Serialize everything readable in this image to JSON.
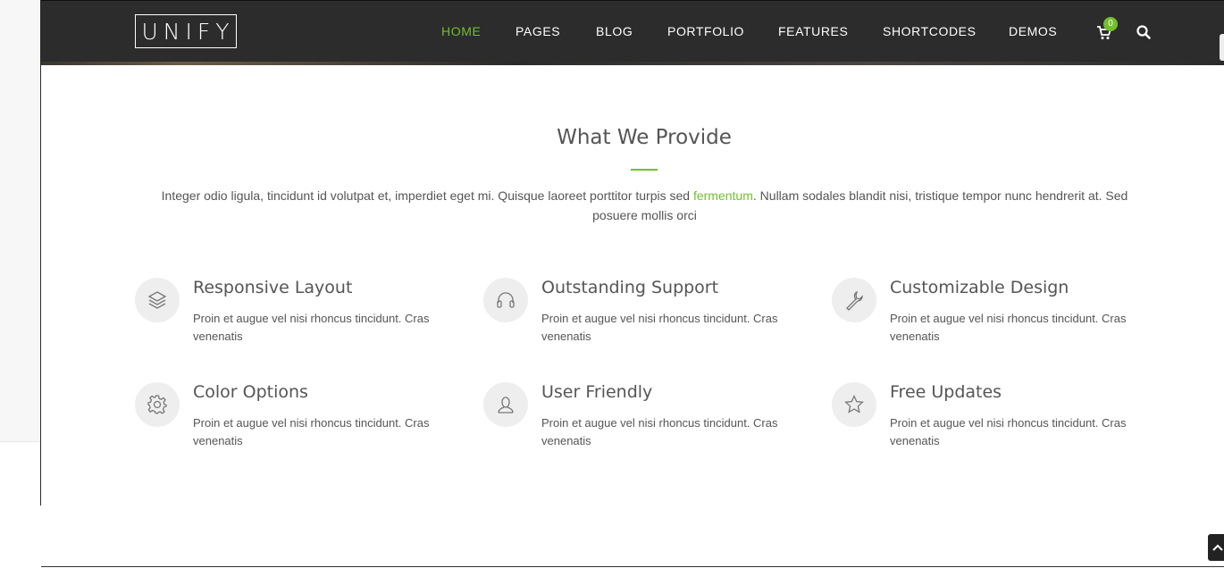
{
  "brand": {
    "logo_text": "UNIFY"
  },
  "nav": {
    "items": [
      {
        "label": "HOME",
        "active": true
      },
      {
        "label": "PAGES",
        "active": false
      },
      {
        "label": "BLOG",
        "active": false
      },
      {
        "label": "PORTFOLIO",
        "active": false
      },
      {
        "label": "FEATURES",
        "active": false
      },
      {
        "label": "SHORTCODES",
        "active": false
      },
      {
        "label": "DEMOS",
        "active": false
      }
    ],
    "cart_count": "0",
    "cart_icon": "shopping-cart-icon",
    "search_icon": "search-icon"
  },
  "section": {
    "title": "What We Provide",
    "intro_before": "Integer odio ligula, tincidunt id volutpat et, imperdiet eget mi. Quisque laoreet porttitor turpis sed ",
    "intro_link": "fermentum",
    "intro_after": ". Nullam sodales blandit nisi, tristique tempor nunc hendrerit at. Sed posuere mollis orci"
  },
  "features": [
    {
      "icon": "layers-icon",
      "title": "Responsive Layout",
      "desc": "Proin et augue vel nisi rhoncus tincidunt. Cras venenatis"
    },
    {
      "icon": "headphones-icon",
      "title": "Outstanding Support",
      "desc": "Proin et augue vel nisi rhoncus tincidunt. Cras venenatis"
    },
    {
      "icon": "wrench-icon",
      "title": "Customizable Design",
      "desc": "Proin et augue vel nisi rhoncus tincidunt. Cras venenatis"
    },
    {
      "icon": "gear-icon",
      "title": "Color Options",
      "desc": "Proin et augue vel nisi rhoncus tincidunt. Cras venenatis"
    },
    {
      "icon": "user-icon",
      "title": "User Friendly",
      "desc": "Proin et augue vel nisi rhoncus tincidunt. Cras venenatis"
    },
    {
      "icon": "star-icon",
      "title": "Free Updates",
      "desc": "Proin et augue vel nisi rhoncus tincidunt. Cras venenatis"
    }
  ],
  "colors": {
    "accent": "#72c02c",
    "navbar": "#2b2c2b",
    "text": "#555555"
  }
}
